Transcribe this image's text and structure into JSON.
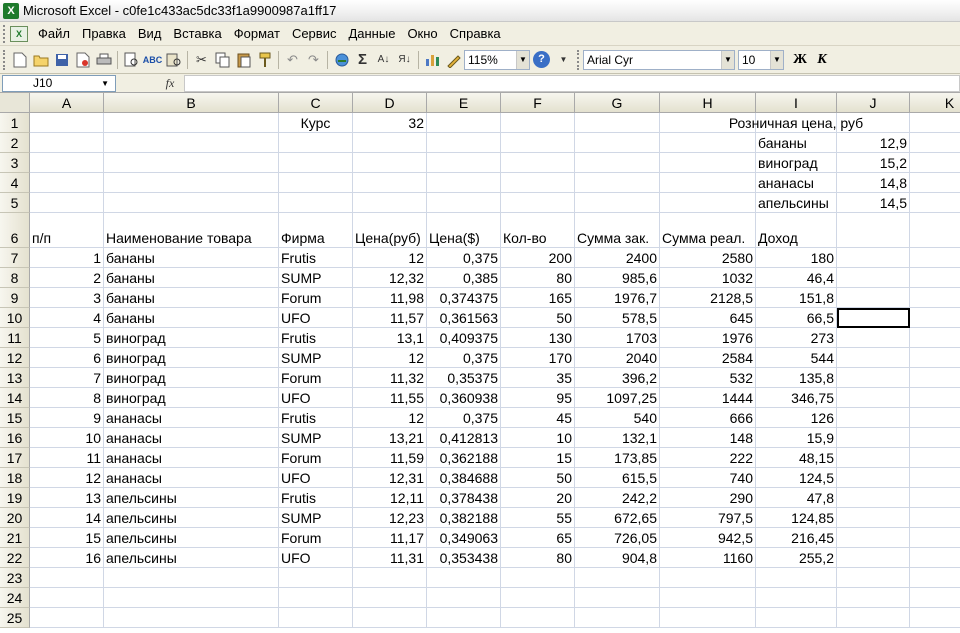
{
  "window": {
    "title": "Microsoft Excel - c0fe1c433ac5dc33f1a9900987a1ff17",
    "app_icon": "X"
  },
  "menu": [
    "Файл",
    "Правка",
    "Вид",
    "Вставка",
    "Формат",
    "Сервис",
    "Данные",
    "Окно",
    "Справка"
  ],
  "toolbar": {
    "zoom": "115%",
    "font_name": "Arial Cyr",
    "font_size": "10",
    "bold_label": "Ж",
    "italic_label": "К",
    "autosum": "Σ",
    "icons": [
      "new-icon",
      "open-icon",
      "save-icon",
      "permission-icon",
      "print-icon",
      "print-preview-icon",
      "spelling-icon",
      "research-icon",
      "cut-icon",
      "copy-icon",
      "paste-icon",
      "format-painter-icon",
      "undo-icon",
      "redo-icon",
      "hyperlink-icon",
      "autosum-icon",
      "sort-ascending-icon",
      "sort-descending-icon",
      "chart-wizard-icon",
      "drawing-icon",
      "help-icon"
    ]
  },
  "formula_bar": {
    "name_box": "J10",
    "fx": "fx",
    "formula": ""
  },
  "grid": {
    "columns": [
      "A",
      "B",
      "C",
      "D",
      "E",
      "F",
      "G",
      "H",
      "I",
      "J",
      "K"
    ],
    "rows": [
      "1",
      "2",
      "3",
      "4",
      "5",
      "6",
      "7",
      "8",
      "9",
      "10",
      "11",
      "12",
      "13",
      "14",
      "15",
      "16",
      "17",
      "18",
      "19",
      "20",
      "21",
      "22",
      "23",
      "24",
      "25"
    ],
    "selected": "J10",
    "cells": {
      "C1": "Курс",
      "D1": "32",
      "I1": "Розничная цена, руб",
      "I2": "бананы",
      "J2": "12,9",
      "I3": "виноград",
      "J3": "15,2",
      "I4": "ананасы",
      "J4": "14,8",
      "I5": "апельсины",
      "J5": "14,5",
      "A6": "п/п",
      "B6": "Наименование товара",
      "C6": "Фирма",
      "D6": "Цена(руб)",
      "E6": "Цена($)",
      "F6": "Кол-во",
      "G6": "Сумма зак.",
      "H6": "Сумма реал.",
      "I6": "Доход",
      "A7": "1",
      "B7": "бананы",
      "C7": "Frutis",
      "D7": "12",
      "E7": "0,375",
      "F7": "200",
      "G7": "2400",
      "H7": "2580",
      "I7": "180",
      "A8": "2",
      "B8": "бананы",
      "C8": "SUMP",
      "D8": "12,32",
      "E8": "0,385",
      "F8": "80",
      "G8": "985,6",
      "H8": "1032",
      "I8": "46,4",
      "A9": "3",
      "B9": "бананы",
      "C9": "Forum",
      "D9": "11,98",
      "E9": "0,374375",
      "F9": "165",
      "G9": "1976,7",
      "H9": "2128,5",
      "I9": "151,8",
      "A10": "4",
      "B10": "бананы",
      "C10": "UFO",
      "D10": "11,57",
      "E10": "0,361563",
      "F10": "50",
      "G10": "578,5",
      "H10": "645",
      "I10": "66,5",
      "A11": "5",
      "B11": "виноград",
      "C11": "Frutis",
      "D11": "13,1",
      "E11": "0,409375",
      "F11": "130",
      "G11": "1703",
      "H11": "1976",
      "I11": "273",
      "A12": "6",
      "B12": "виноград",
      "C12": "SUMP",
      "D12": "12",
      "E12": "0,375",
      "F12": "170",
      "G12": "2040",
      "H12": "2584",
      "I12": "544",
      "A13": "7",
      "B13": "виноград",
      "C13": "Forum",
      "D13": "11,32",
      "E13": "0,35375",
      "F13": "35",
      "G13": "396,2",
      "H13": "532",
      "I13": "135,8",
      "A14": "8",
      "B14": "виноград",
      "C14": "UFO",
      "D14": "11,55",
      "E14": "0,360938",
      "F14": "95",
      "G14": "1097,25",
      "H14": "1444",
      "I14": "346,75",
      "A15": "9",
      "B15": "ананасы",
      "C15": "Frutis",
      "D15": "12",
      "E15": "0,375",
      "F15": "45",
      "G15": "540",
      "H15": "666",
      "I15": "126",
      "A16": "10",
      "B16": "ананасы",
      "C16": "SUMP",
      "D16": "13,21",
      "E16": "0,412813",
      "F16": "10",
      "G16": "132,1",
      "H16": "148",
      "I16": "15,9",
      "A17": "11",
      "B17": "ананасы",
      "C17": "Forum",
      "D17": "11,59",
      "E17": "0,362188",
      "F17": "15",
      "G17": "173,85",
      "H17": "222",
      "I17": "48,15",
      "A18": "12",
      "B18": "ананасы",
      "C18": "UFO",
      "D18": "12,31",
      "E18": "0,384688",
      "F18": "50",
      "G18": "615,5",
      "H18": "740",
      "I18": "124,5",
      "A19": "13",
      "B19": "апельсины",
      "C19": "Frutis",
      "D19": "12,11",
      "E19": "0,378438",
      "F19": "20",
      "G19": "242,2",
      "H19": "290",
      "I19": "47,8",
      "A20": "14",
      "B20": "апельсины",
      "C20": "SUMP",
      "D20": "12,23",
      "E20": "0,382188",
      "F20": "55",
      "G20": "672,65",
      "H20": "797,5",
      "I20": "124,85",
      "A21": "15",
      "B21": "апельсины",
      "C21": "Forum",
      "D21": "11,17",
      "E21": "0,349063",
      "F21": "65",
      "G21": "726,05",
      "H21": "942,5",
      "I21": "216,45",
      "A22": "16",
      "B22": "апельсины",
      "C22": "UFO",
      "D22": "11,31",
      "E22": "0,353438",
      "F22": "80",
      "G22": "904,8",
      "H22": "1160",
      "I22": "255,2"
    }
  }
}
